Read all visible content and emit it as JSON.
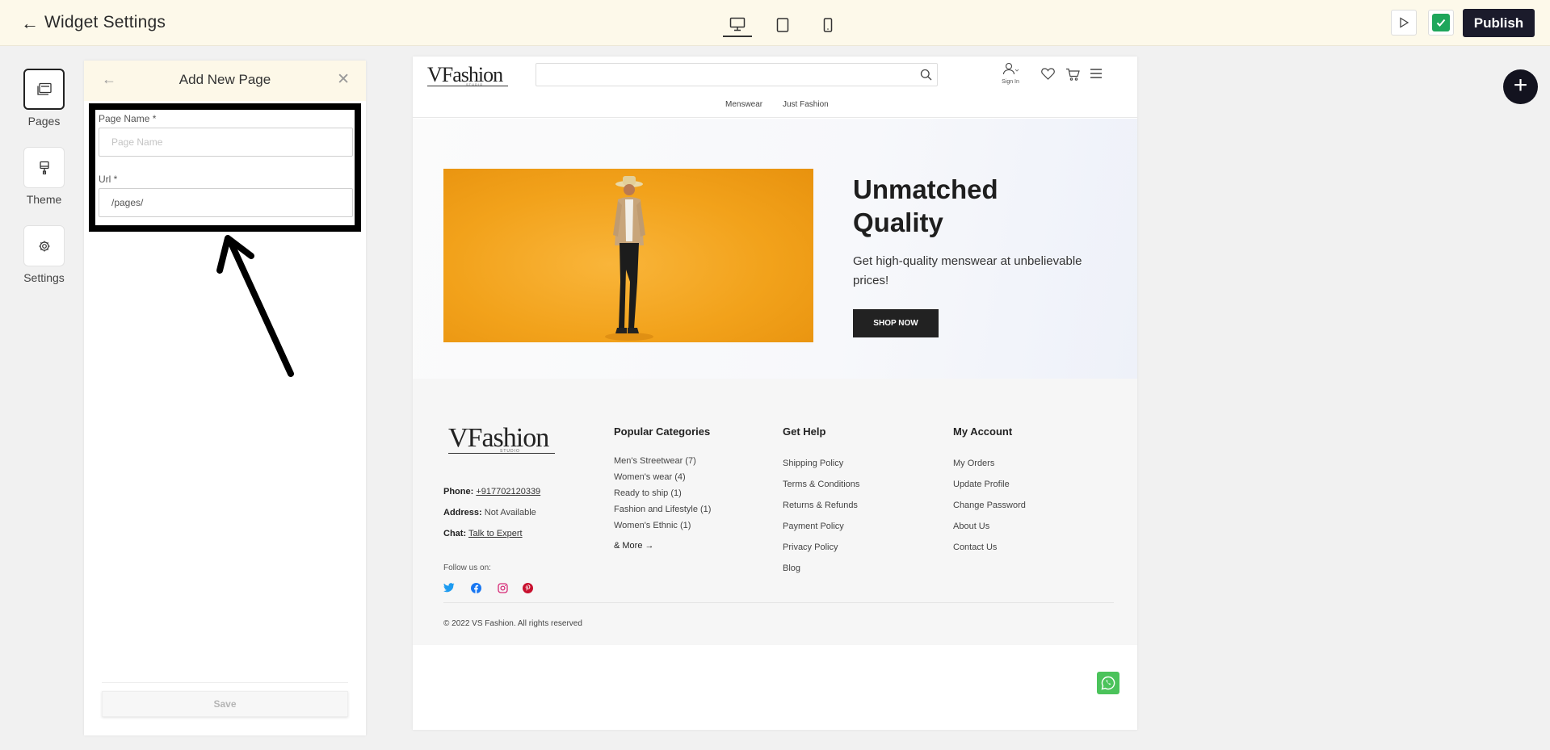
{
  "topbar": {
    "title": "Widget Settings",
    "publish_label": "Publish"
  },
  "rail": {
    "items": [
      {
        "label": "Pages"
      },
      {
        "label": "Theme"
      },
      {
        "label": "Settings"
      }
    ]
  },
  "panel": {
    "title": "Add New Page",
    "fields": {
      "page_name_label": "Page Name *",
      "page_name_placeholder": "Page Name",
      "url_label": "Url *",
      "url_value": "/pages/"
    },
    "save_label": "Save"
  },
  "site": {
    "logo": "VFashion",
    "logo_sub": "STUDIO",
    "header": {
      "signin": "Sign In",
      "nav": [
        "Menswear",
        "Just Fashion"
      ]
    },
    "hero": {
      "heading": "Unmatched Quality",
      "subheading": "Get high-quality menswear at unbelievable prices!",
      "cta": "SHOP NOW"
    },
    "footer": {
      "phone_label": "Phone:",
      "phone": "+917702120339",
      "address_label": "Address:",
      "address": "Not Available",
      "chat_label": "Chat:",
      "chat": "Talk to Expert",
      "follow": "Follow us on:",
      "columns": [
        {
          "title": "Popular Categories",
          "items": [
            "Men's Streetwear (7)",
            "Women's wear (4)",
            "Ready to ship (1)",
            "Fashion and Lifestyle (1)",
            "Women's Ethnic (1)"
          ],
          "more": "& More"
        },
        {
          "title": "Get Help",
          "items": [
            "Shipping Policy",
            "Terms & Conditions",
            "Returns & Refunds",
            "Payment Policy",
            "Privacy Policy",
            "Blog"
          ]
        },
        {
          "title": "My Account",
          "items": [
            "My Orders",
            "Update Profile",
            "Change Password",
            "About Us",
            "Contact Us"
          ]
        }
      ],
      "copyright": "© 2022 VS Fashion. All rights reserved"
    }
  },
  "colors": {
    "topbar_bg": "#fdf9ea",
    "publish_bg": "#1b1b2b",
    "check_green": "#1ea65b",
    "whatsapp": "#4bc35b",
    "hero_orange": "#f2a21b"
  }
}
